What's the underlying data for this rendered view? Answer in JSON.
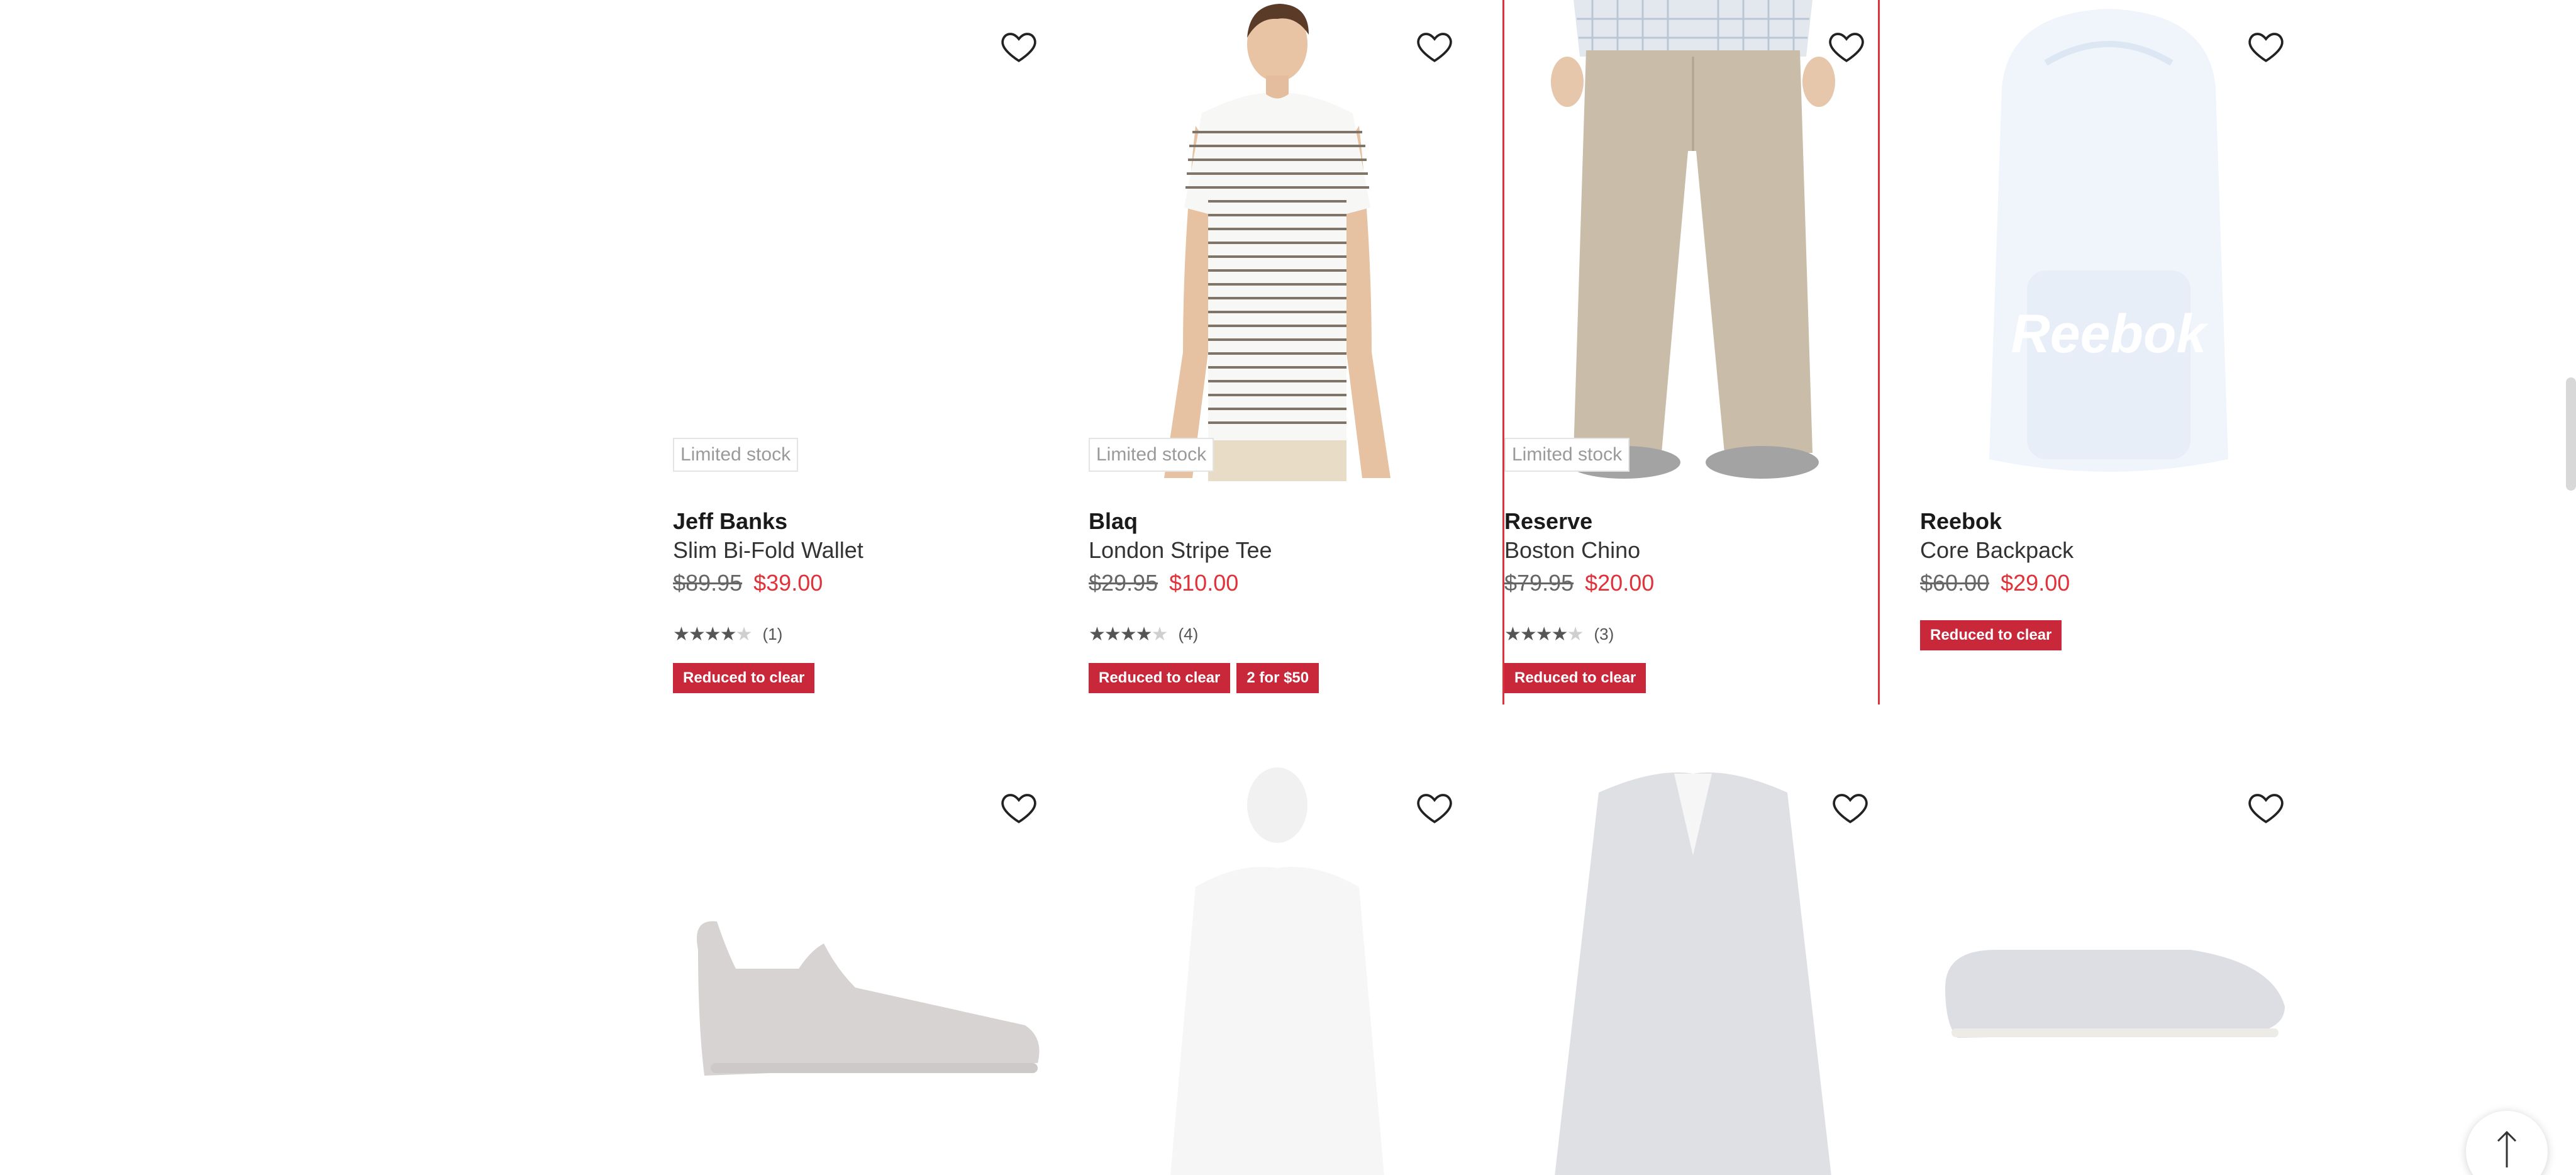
{
  "products_row1": [
    {
      "limited": "Limited stock",
      "brand": "Jeff Banks",
      "name": "Slim Bi-Fold Wallet",
      "was": "$89.95",
      "now": "$39.00",
      "rating": 4,
      "count": "(1)",
      "badges": [
        "Reduced to clear"
      ]
    },
    {
      "limited": "Limited stock",
      "brand": "Blaq",
      "name": "London Stripe Tee",
      "was": "$29.95",
      "now": "$10.00",
      "rating": 4.5,
      "count": "(4)",
      "badges": [
        "Reduced to clear",
        "2 for $50"
      ]
    },
    {
      "limited": "Limited stock",
      "brand": "Reserve",
      "name": "Boston Chino",
      "was": "$79.95",
      "now": "$20.00",
      "rating": 4.5,
      "count": "(3)",
      "badges": [
        "Reduced to clear"
      ]
    },
    {
      "brand": "Reebok",
      "name": "Core Backpack",
      "was": "$60.00",
      "now": "$29.00",
      "badges": [
        "Reduced to clear"
      ],
      "logo_text": "Reebok"
    }
  ],
  "colors": {
    "accent_red": "#e0323a",
    "badge_red": "#c8283a"
  },
  "icons": {
    "wishlist": "heart-outline-icon",
    "back_to_top": "arrow-up-icon"
  }
}
